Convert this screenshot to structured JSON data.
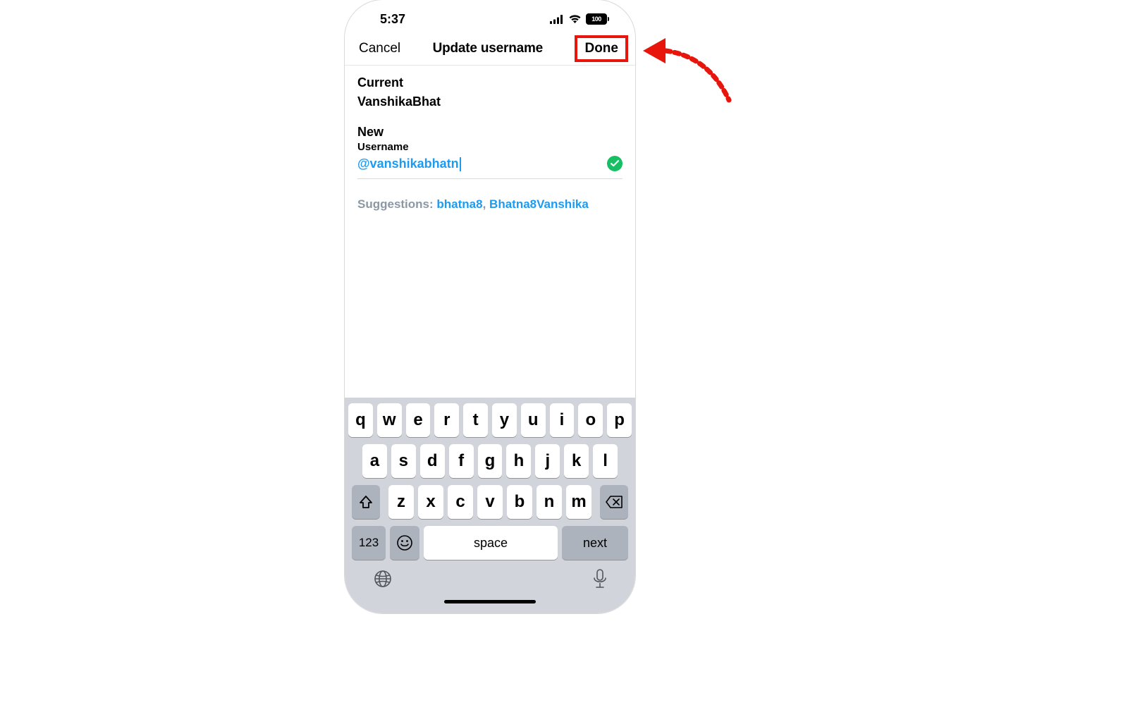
{
  "status": {
    "time": "5:37",
    "battery": "100"
  },
  "nav": {
    "cancel": "Cancel",
    "title": "Update username",
    "done": "Done"
  },
  "form": {
    "current_label": "Current",
    "current_value": "VanshikaBhat",
    "new_label": "New",
    "username_label": "Username",
    "input_value": "@vanshikabhatn",
    "valid": true
  },
  "suggestions": {
    "label": "Suggestions: ",
    "items": [
      "bhatna8",
      "Bhatna8Vanshika"
    ]
  },
  "keyboard": {
    "row1": [
      "q",
      "w",
      "e",
      "r",
      "t",
      "y",
      "u",
      "i",
      "o",
      "p"
    ],
    "row2": [
      "a",
      "s",
      "d",
      "f",
      "g",
      "h",
      "j",
      "k",
      "l"
    ],
    "row3": [
      "z",
      "x",
      "c",
      "v",
      "b",
      "n",
      "m"
    ],
    "key_123": "123",
    "space": "space",
    "next": "next"
  }
}
